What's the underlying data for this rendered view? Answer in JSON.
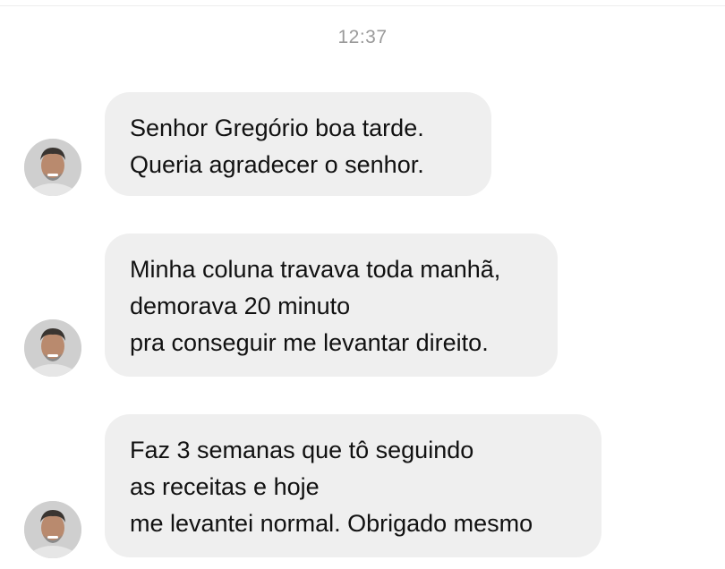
{
  "chat": {
    "timestamp": "12:37",
    "messages": [
      {
        "lines": [
          "Senhor Gregório boa tarde.",
          "Queria agradecer o senhor."
        ]
      },
      {
        "lines": [
          "Minha coluna travava toda manhã,",
          "demorava 20 minuto",
          "pra conseguir me levantar direito."
        ]
      },
      {
        "lines": [
          "Faz 3 semanas que tô seguindo",
          "as receitas e hoje",
          "me levantei normal. Obrigado mesmo"
        ]
      }
    ]
  },
  "colors": {
    "bubble_background": "#efefef",
    "timestamp_text": "#9a9a9a",
    "message_text": "#111111"
  },
  "icons": {
    "avatar": "user-avatar-photo"
  }
}
